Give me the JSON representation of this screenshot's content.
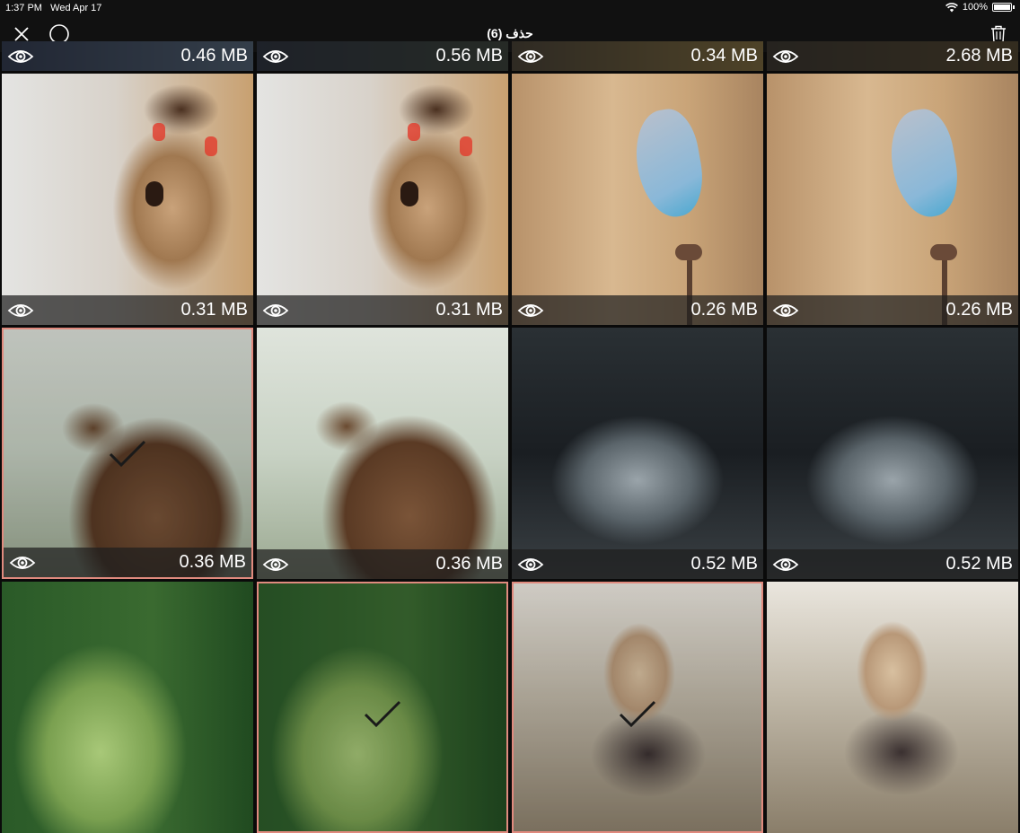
{
  "status": {
    "time": "1:37 PM",
    "date": "Wed Apr 17",
    "battery": "100%"
  },
  "nav": {
    "title": "حذف (6)"
  },
  "top_row": [
    "0.46 MB",
    "0.56 MB",
    "0.34 MB",
    "2.68 MB"
  ],
  "rows": [
    [
      {
        "subject": "pug",
        "size": "0.31 MB",
        "selected": false
      },
      {
        "subject": "pug",
        "size": "0.31 MB",
        "selected": false
      },
      {
        "subject": "butterfly",
        "size": "0.26 MB",
        "selected": false
      },
      {
        "subject": "butterfly",
        "size": "0.26 MB",
        "selected": false
      }
    ],
    [
      {
        "subject": "eagle",
        "size": "0.36 MB",
        "selected": true
      },
      {
        "subject": "eagle",
        "size": "0.36 MB",
        "selected": false
      },
      {
        "subject": "water-splash",
        "size": "0.52 MB",
        "selected": false
      },
      {
        "subject": "water-splash",
        "size": "0.52 MB",
        "selected": false
      }
    ],
    [
      {
        "subject": "leaf-ants",
        "selected": false
      },
      {
        "subject": "leaf-ants",
        "selected": true
      },
      {
        "subject": "girl-field",
        "selected": true
      },
      {
        "subject": "girl-field",
        "selected": false
      }
    ]
  ],
  "colors": {
    "select_border": "#e08a7e",
    "bar_bg": "#111111"
  }
}
